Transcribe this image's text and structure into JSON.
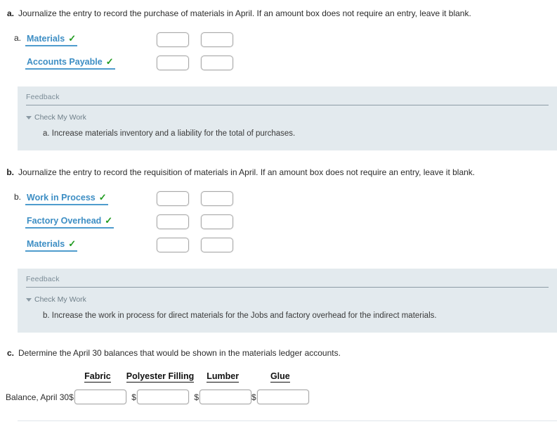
{
  "colors": {
    "account_link": "#3d8ec4",
    "check_mark": "#1f9b1f",
    "feedback_bg": "#e3eaee",
    "feedback_label": "#7b8c97"
  },
  "parts": [
    {
      "letter": "a.",
      "prompt": "Journalize the entry to record the purchase of materials in April. If an amount box does not require an entry, leave it blank.",
      "entry_marker": "a.",
      "lines": [
        {
          "account": "Materials",
          "status_icon": "check-icon",
          "debit": "",
          "credit": ""
        },
        {
          "account": "Accounts Payable",
          "status_icon": "check-icon",
          "debit": "",
          "credit": ""
        }
      ],
      "feedback": {
        "title": "Feedback",
        "toggle_label": "Check My Work",
        "toggle_icon": "caret-down-icon",
        "body": "a. Increase materials inventory and a liability for the total of purchases."
      }
    },
    {
      "letter": "b.",
      "prompt": "Journalize the entry to record the requisition of materials in April. If an amount box does not require an entry, leave it blank.",
      "entry_marker": "b.",
      "lines": [
        {
          "account": "Work in Process",
          "status_icon": "check-icon",
          "debit": "",
          "credit": ""
        },
        {
          "account": "Factory Overhead",
          "status_icon": "check-icon",
          "debit": "",
          "credit": ""
        },
        {
          "account": "Materials",
          "status_icon": "check-icon",
          "debit": "",
          "credit": ""
        }
      ],
      "feedback": {
        "title": "Feedback",
        "toggle_label": "Check My Work",
        "toggle_icon": "caret-down-icon",
        "body": "b. Increase the work in process for direct materials for the Jobs and factory overhead for the indirect materials."
      }
    }
  ],
  "part_c": {
    "letter": "c.",
    "prompt": "Determine the April 30 balances that would be shown in the materials ledger accounts.",
    "columns": [
      "Fabric",
      "Polyester Filling",
      "Lumber",
      "Glue"
    ],
    "row_label": "Balance, April 30",
    "currency_symbol": "$",
    "values": [
      "",
      "",
      "",
      ""
    ]
  },
  "glyphs": {
    "check": "✓"
  }
}
